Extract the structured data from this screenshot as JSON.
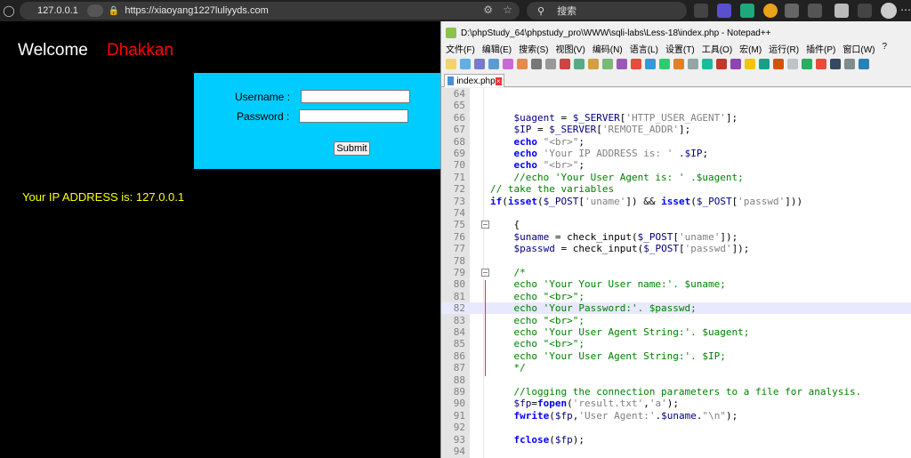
{
  "browser": {
    "host": "127.0.0.1",
    "url": "https://xiaoyang1227luliyyds.com",
    "search_label": "搜索"
  },
  "page": {
    "welcome": "Welcome",
    "name": "Dhakkan",
    "username_label": "Username :",
    "password_label": "Password :",
    "submit_label": "Submit",
    "ip_text": "Your IP ADDRESS is: 127.0.0.1"
  },
  "npp": {
    "title": "D:\\phpStudy_64\\phpstudy_pro\\WWW\\sqli-labs\\Less-18\\index.php - Notepad++",
    "menus": [
      "文件(F)",
      "编辑(E)",
      "搜索(S)",
      "视图(V)",
      "编码(N)",
      "语言(L)",
      "设置(T)",
      "工具(O)",
      "宏(M)",
      "运行(R)",
      "插件(P)",
      "窗口(W)",
      "?"
    ],
    "tab": "index.php",
    "lines": [
      {
        "n": "64",
        "t": ""
      },
      {
        "n": "65",
        "t": ""
      },
      {
        "n": "66",
        "t": "    $uagent = $_SERVER['HTTP_USER_AGENT'];"
      },
      {
        "n": "67",
        "t": "    $IP = $_SERVER['REMOTE_ADDR'];"
      },
      {
        "n": "68",
        "t": "    echo \"<br>\";"
      },
      {
        "n": "69",
        "t": "    echo 'Your IP ADDRESS is: ' .$IP;"
      },
      {
        "n": "70",
        "t": "    echo \"<br>\";"
      },
      {
        "n": "71",
        "t": "    //echo 'Your User Agent is: ' .$uagent;"
      },
      {
        "n": "72",
        "t": "// take the variables"
      },
      {
        "n": "73",
        "t": "if(isset($_POST['uname']) && isset($_POST['passwd']))"
      },
      {
        "n": "74",
        "t": ""
      },
      {
        "n": "75",
        "t": "    {"
      },
      {
        "n": "76",
        "t": "    $uname = check_input($_POST['uname']);"
      },
      {
        "n": "77",
        "t": "    $passwd = check_input($_POST['passwd']);"
      },
      {
        "n": "78",
        "t": ""
      },
      {
        "n": "79",
        "t": "    /*"
      },
      {
        "n": "80",
        "t": "    echo 'Your Your User name:'. $uname;"
      },
      {
        "n": "81",
        "t": "    echo \"<br>\";"
      },
      {
        "n": "82",
        "t": "    echo 'Your Password:'. $passwd;"
      },
      {
        "n": "83",
        "t": "    echo \"<br>\";"
      },
      {
        "n": "84",
        "t": "    echo 'Your User Agent String:'. $uagent;"
      },
      {
        "n": "85",
        "t": "    echo \"<br>\";"
      },
      {
        "n": "86",
        "t": "    echo 'Your User Agent String:'. $IP;"
      },
      {
        "n": "87",
        "t": "    */"
      },
      {
        "n": "88",
        "t": ""
      },
      {
        "n": "89",
        "t": "    //logging the connection parameters to a file for analysis."
      },
      {
        "n": "90",
        "t": "    $fp=fopen('result.txt','a');"
      },
      {
        "n": "91",
        "t": "    fwrite($fp,'User Agent:'.$uname.\"\\n\");"
      },
      {
        "n": "92",
        "t": ""
      },
      {
        "n": "93",
        "t": "    fclose($fp);"
      },
      {
        "n": "94",
        "t": ""
      }
    ]
  }
}
